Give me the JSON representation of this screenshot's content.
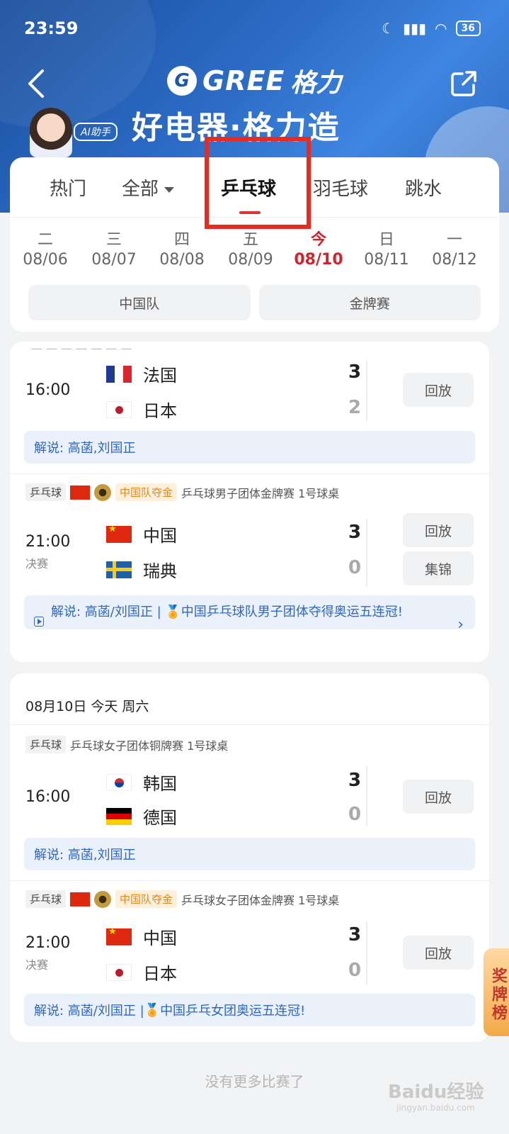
{
  "status_bar": {
    "time": "23:59",
    "battery": "36"
  },
  "header": {
    "brand_en": "GREE",
    "brand_cn": "格力",
    "slogan": "好电器·格力造",
    "ai_label": "AI助手"
  },
  "tabs": [
    {
      "label": "热门"
    },
    {
      "label": "全部"
    },
    {
      "label": "乒乓球"
    },
    {
      "label": "羽毛球"
    },
    {
      "label": "跳水"
    }
  ],
  "dates": [
    {
      "weekday": "二",
      "date": "08/06"
    },
    {
      "weekday": "三",
      "date": "08/07"
    },
    {
      "weekday": "四",
      "date": "08/08"
    },
    {
      "weekday": "五",
      "date": "08/09"
    },
    {
      "weekday": "今",
      "date": "08/10"
    },
    {
      "weekday": "日",
      "date": "08/11"
    },
    {
      "weekday": "一",
      "date": "08/12"
    }
  ],
  "filters": {
    "team": "中国队",
    "gold": "金牌赛"
  },
  "matches": [
    {
      "time": "16:00",
      "team1": "法国",
      "score1": "3",
      "team2": "日本",
      "score2": "2",
      "button1": "回放",
      "commentary": "解说: 高菡,刘国正"
    },
    {
      "sport": "乒乓球",
      "badge": "中国队夺金",
      "event": "乒乓球男子团体金牌赛 1号球桌",
      "time": "21:00",
      "stage": "决赛",
      "team1": "中国",
      "score1": "3",
      "team2": "瑞典",
      "score2": "0",
      "button1": "回放",
      "button2": "集锦",
      "commentary_prefix": "解说: 高菡/刘国正 | ",
      "commentary_highlight": "中国乒乓球队男子团体夺得奥运五连冠!"
    },
    {
      "sport": "乒乓球",
      "event": "乒乓球女子团体铜牌赛 1号球桌",
      "time": "16:00",
      "team1": "韩国",
      "score1": "3",
      "team2": "德国",
      "score2": "0",
      "button1": "回放",
      "commentary": "解说: 高菡,刘国正"
    },
    {
      "sport": "乒乓球",
      "badge": "中国队夺金",
      "event": "乒乓球女子团体金牌赛 1号球桌",
      "time": "21:00",
      "stage": "决赛",
      "team1": "中国",
      "score1": "3",
      "team2": "日本",
      "score2": "0",
      "button1": "回放",
      "commentary_prefix": "解说: 高菡/刘国正 | ",
      "commentary_highlight": "中国乒乓女团奥运五连冠!"
    }
  ],
  "day_header": "08月10日 今天 周六",
  "no_more": "没有更多比赛了",
  "medal_tab": "奖牌榜",
  "watermark": {
    "main": "Baidu经验",
    "sub": "jingyan.baidu.com"
  }
}
